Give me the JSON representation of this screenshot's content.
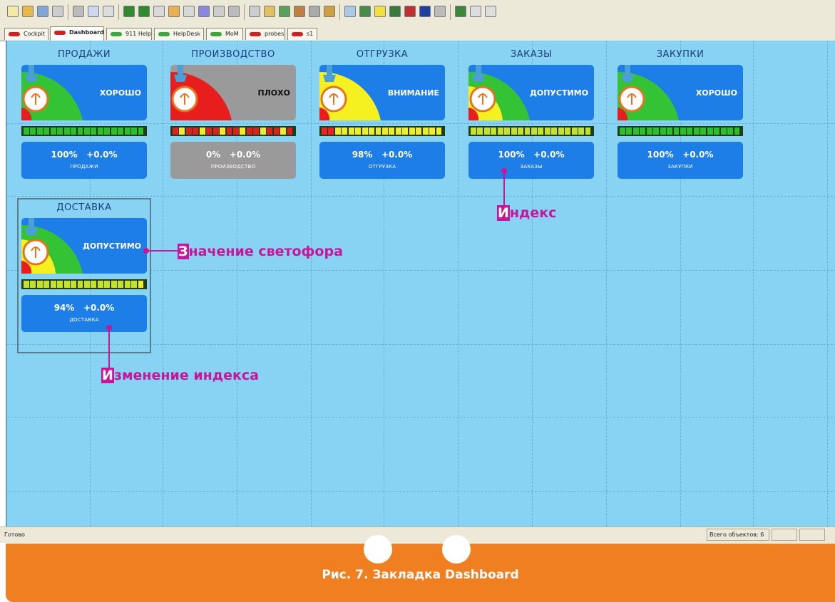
{
  "tabs": [
    {
      "label": "Cockpit",
      "led": "#d42020"
    },
    {
      "label": "Dashboard",
      "led": "#d42020"
    },
    {
      "label": "911 Help",
      "led": "#3aa83a"
    },
    {
      "label": "HelpDesk",
      "led": "#3aa83a"
    },
    {
      "label": "MoM",
      "led": "#3aa83a"
    },
    {
      "label": "probes",
      "led": "#d42020"
    },
    {
      "label": "s1",
      "led": "#d42020"
    }
  ],
  "widgets": [
    {
      "title": "ПРОДАЖИ",
      "status": "ХОРОШО",
      "state": "good",
      "index": "100%",
      "change": "+0.0%",
      "label": "ПРОДАЖИ"
    },
    {
      "title": "ПРОИЗВОДСТВО",
      "status": "ПЛОХО",
      "state": "bad",
      "index": "0%",
      "change": "+0.0%",
      "label": "ПРОИЗВОДСТВО"
    },
    {
      "title": "ОТГРУЗКА",
      "status": "ВНИМАНИЕ",
      "state": "warn",
      "index": "98%",
      "change": "+0.0%",
      "label": "ОТГРУЗКА"
    },
    {
      "title": "ЗАКАЗЫ",
      "status": "ДОПУСТИМО",
      "state": "ok",
      "index": "100%",
      "change": "+0.0%",
      "label": "ЗАКАЗЫ"
    },
    {
      "title": "ЗАКУПКИ",
      "status": "ХОРОШО",
      "state": "good",
      "index": "100%",
      "change": "+0.0%",
      "label": "ЗАКУПКИ"
    },
    {
      "title": "ДОСТАВКА",
      "status": "ДОПУСТИМО",
      "state": "ok",
      "index": "94%",
      "change": "+0.0%",
      "label": "ДОСТАВКА"
    }
  ],
  "annotations": {
    "index": {
      "cap": "И",
      "rest": "ндекс"
    },
    "signal": {
      "cap": "З",
      "rest": "начение светофора"
    },
    "change": {
      "cap": "И",
      "rest": "зменение индекса"
    }
  },
  "statusbar": {
    "text": "Готово",
    "objects": "Всего объектов: 6"
  },
  "footer": {
    "caption": "Рис. 7. Закладка Dashboard"
  },
  "colors": {
    "canvas": "#88d2f4",
    "panel": "#1e7ee8",
    "panel_bad": "#9a9a9a",
    "accent": "#c8159a",
    "footer": "#f07f22"
  }
}
